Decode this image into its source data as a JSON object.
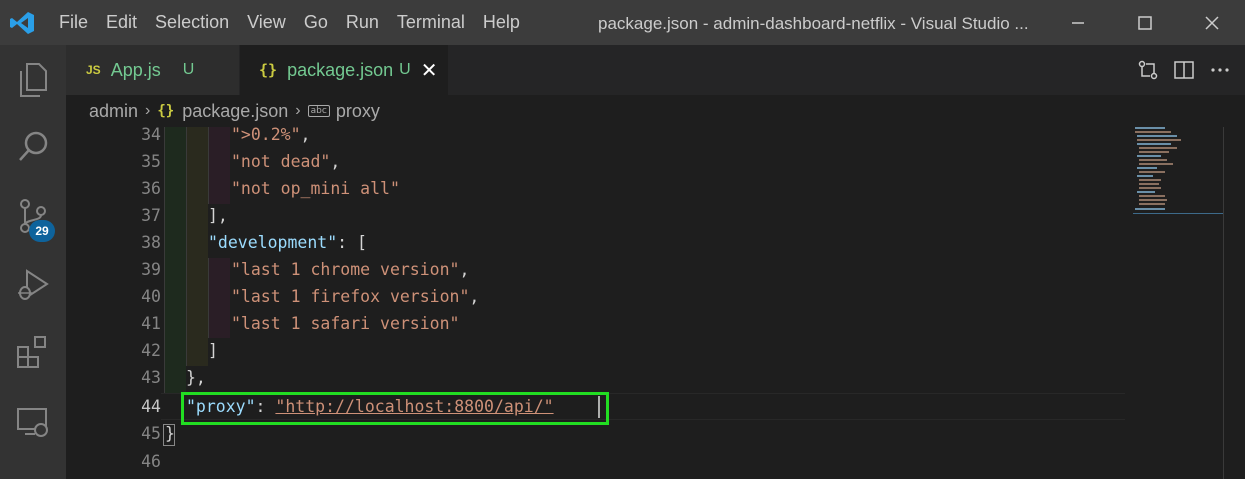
{
  "window": {
    "title": "package.json - admin-dashboard-netflix - Visual Studio ...",
    "menu": [
      "File",
      "Edit",
      "Selection",
      "View",
      "Go",
      "Run",
      "Terminal",
      "Help"
    ]
  },
  "activity_bar": {
    "items": [
      "explorer-icon",
      "search-icon",
      "source-control-icon",
      "run-debug-icon",
      "extensions-icon",
      "remote-explorer-icon"
    ],
    "source_control_badge": "29"
  },
  "tabs": [
    {
      "icon": "JS",
      "label": "App.js",
      "status": "U",
      "active": false
    },
    {
      "icon": "{}",
      "label": "package.json",
      "status": "U",
      "active": true
    }
  ],
  "breadcrumb": {
    "items": [
      "admin",
      "package.json",
      "proxy"
    ],
    "file_icon": "{}",
    "symbol_icon": "abc"
  },
  "editor": {
    "line_numbers": [
      "34",
      "35",
      "36",
      "37",
      "38",
      "39",
      "40",
      "41",
      "42",
      "43",
      "44",
      "45",
      "46"
    ],
    "active_line": "44",
    "lines": {
      "l34": {
        "str": "\">0.2%\"",
        "punct": ","
      },
      "l35": {
        "str": "\"not dead\"",
        "punct": ","
      },
      "l36": {
        "str": "\"not op_mini all\""
      },
      "l37": {
        "punct": "],"
      },
      "l38": {
        "key": "\"development\"",
        "punct": ": ["
      },
      "l39": {
        "str": "\"last 1 chrome version\"",
        "punct": ","
      },
      "l40": {
        "str": "\"last 1 firefox version\"",
        "punct": ","
      },
      "l41": {
        "str": "\"last 1 safari version\""
      },
      "l42": {
        "punct": "]"
      },
      "l43": {
        "punct": "},"
      },
      "l44": {
        "key": "\"proxy\"",
        "punct": ": ",
        "str": "\"http://localhost:8800/api/\""
      },
      "l45": {
        "punct": "}"
      }
    }
  },
  "colors": {
    "highlight_box": "#22dd22",
    "string": "#ce9178",
    "key": "#9cdcfe",
    "badge": "#0e639c",
    "modified": "#73c991"
  }
}
